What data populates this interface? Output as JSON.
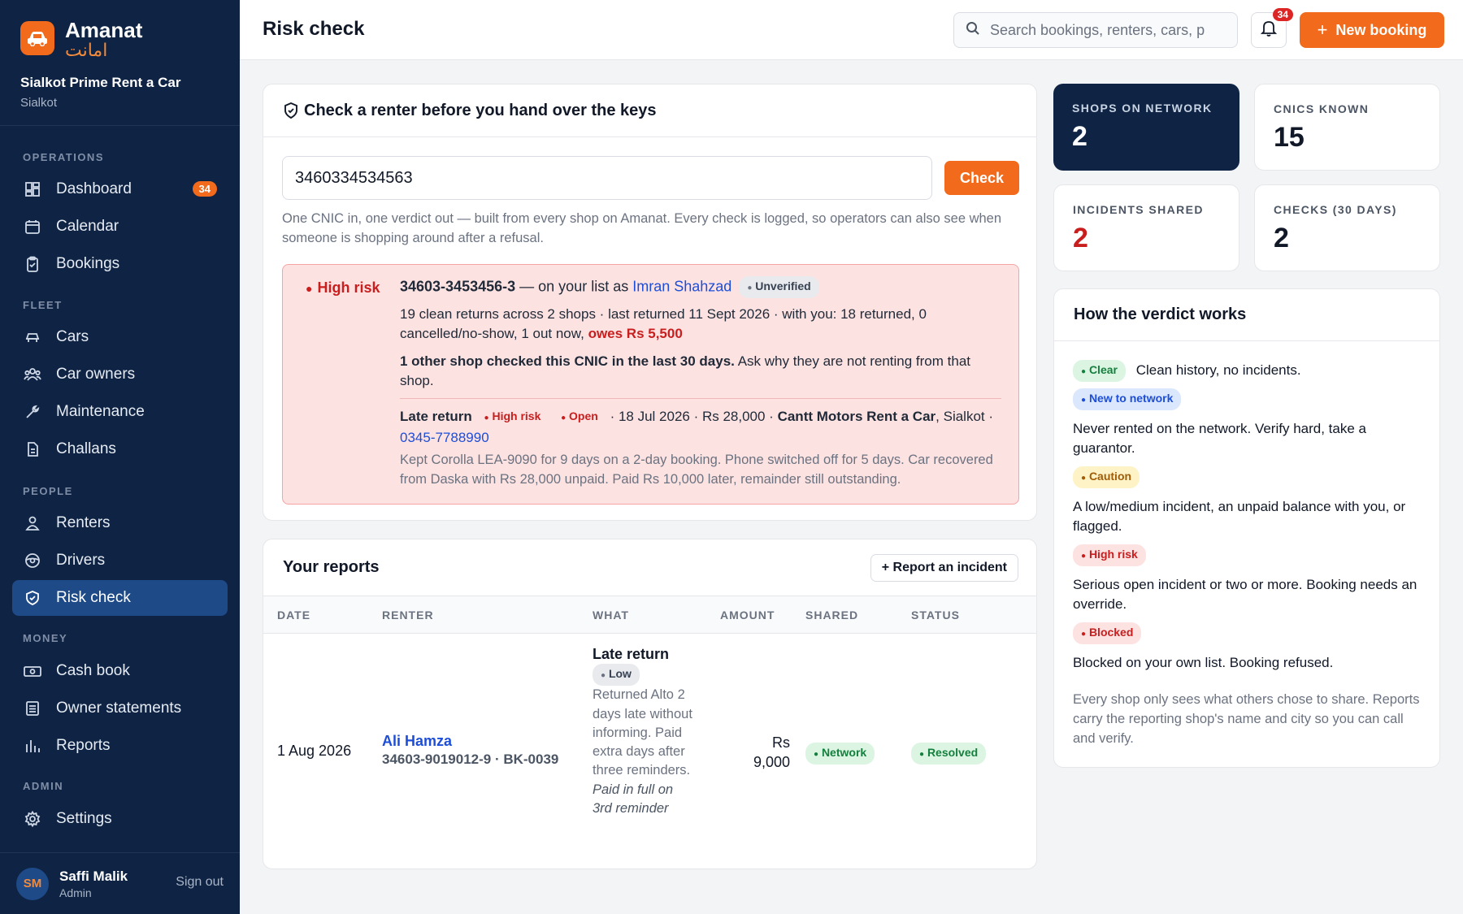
{
  "brand": {
    "name": "Amanat",
    "urdu": "امانت",
    "shop_name": "Sialkot Prime Rent a Car",
    "shop_city": "Sialkot"
  },
  "nav": {
    "sections": {
      "operations": "OPERATIONS",
      "fleet": "FLEET",
      "people": "PEOPLE",
      "money": "MONEY",
      "admin": "ADMIN"
    },
    "items": {
      "dashboard": "Dashboard",
      "dashboard_badge": "34",
      "calendar": "Calendar",
      "bookings": "Bookings",
      "cars": "Cars",
      "car_owners": "Car owners",
      "maintenance": "Maintenance",
      "challans": "Challans",
      "renters": "Renters",
      "drivers": "Drivers",
      "risk_check": "Risk check",
      "cash_book": "Cash book",
      "owner_statements": "Owner statements",
      "reports": "Reports",
      "settings": "Settings"
    }
  },
  "user": {
    "initials": "SM",
    "name": "Saffi Malik",
    "role": "Admin",
    "sign_out": "Sign out"
  },
  "topbar": {
    "title": "Risk check",
    "search_placeholder": "Search bookings, renters, cars, p",
    "notifications": "34",
    "new_booking": "New booking"
  },
  "check": {
    "heading": "Check a renter before you hand over the keys",
    "input_value": "3460334534563",
    "button": "Check",
    "help": "One CNIC in, one verdict out — built from every shop on Amanat. Every check is logged, so operators can also see when someone is shopping around after a refusal."
  },
  "result": {
    "verdict": "High risk",
    "cnic": "34603-3453456-3",
    "on_list": "— on your list as",
    "renter_name": "Imran Shahzad",
    "status": "Unverified",
    "history": "19 clean returns across 2 shops · last returned 11 Sept 2026 · with you: 18 returned, 0 cancelled/no-show, 1 out now,",
    "owes": "owes Rs 5,500",
    "other_shop_bold": "1 other shop checked this CNIC in the last 30 days.",
    "other_shop_text": "Ask why they are not renting from that shop.",
    "incident": {
      "type": "Late return",
      "severity": "High risk",
      "state": "Open",
      "details": "· 18 Jul 2026 · Rs 28,000 ·",
      "shop": "Cantt Motors Rent a Car",
      "city": ", Sialkot ·",
      "phone": "0345-7788990",
      "description": "Kept Corolla LEA-9090 for 9 days on a 2-day booking. Phone switched off for 5 days. Car recovered from Daska with Rs 28,000 unpaid. Paid Rs 10,000 later, remainder still outstanding."
    }
  },
  "reports": {
    "heading": "Your reports",
    "button": "+ Report an incident",
    "columns": [
      "DATE",
      "RENTER",
      "WHAT",
      "AMOUNT",
      "SHARED",
      "STATUS"
    ],
    "rows": [
      {
        "date": "1 Aug 2026",
        "renter": "Ali Hamza",
        "renter_meta": "34603-9019012-9 · BK-0039",
        "what": "Late return",
        "severity": "Low",
        "description": "Returned Alto 2 days late without informing. Paid extra days after three reminders.",
        "note": "Paid in full on 3rd reminder",
        "amount": "Rs 9,000",
        "shared": "Network",
        "status": "Resolved"
      }
    ]
  },
  "stats": [
    {
      "label": "SHOPS ON NETWORK",
      "value": "2"
    },
    {
      "label": "CNICS KNOWN",
      "value": "15"
    },
    {
      "label": "INCIDENTS SHARED",
      "value": "2"
    },
    {
      "label": "CHECKS (30 DAYS)",
      "value": "2"
    }
  ],
  "verdict_guide": {
    "heading": "How the verdict works",
    "clear": "Clear",
    "clear_desc": "Clean history, no incidents.",
    "new": "New to network",
    "new_desc": "Never rented on the network. Verify hard, take a guarantor.",
    "caution": "Caution",
    "caution_desc": "A low/medium incident, an unpaid balance with you, or flagged.",
    "high": "High risk",
    "high_desc": "Serious open incident or two or more. Booking needs an override.",
    "blocked": "Blocked",
    "blocked_desc": "Blocked on your own list. Booking refused.",
    "footer": "Every shop only sees what others chose to share. Reports carry the reporting shop's name and city so you can call and verify."
  },
  "colors": {
    "sidebar": "#0f2444",
    "accent": "#f26a1b",
    "active_nav": "#1e4a88",
    "danger": "#c81e1e"
  }
}
